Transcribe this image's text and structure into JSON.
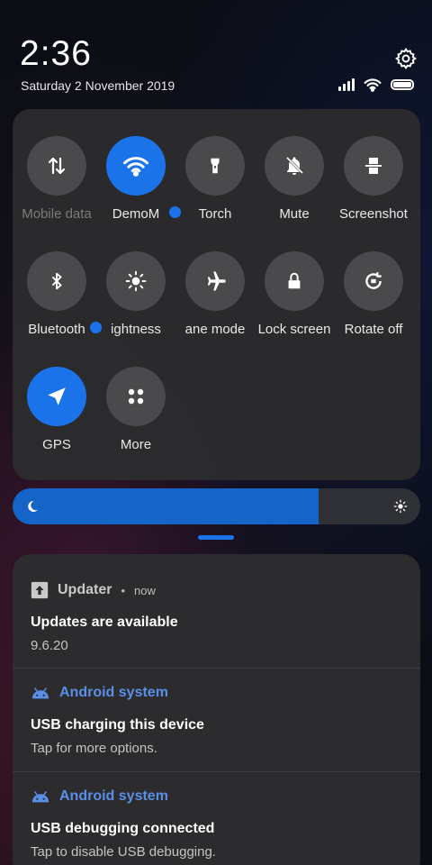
{
  "status_bar": {
    "time": "2:36",
    "date": "Saturday 2 November 2019",
    "settings_icon": "gear-icon",
    "signal_icon": "signal-bars-icon",
    "wifi_icon": "wifi-icon",
    "battery_icon": "battery-icon"
  },
  "quick_settings": {
    "tiles": [
      {
        "label": "Mobile data",
        "icon": "mobile-data-icon",
        "state": "unavailable"
      },
      {
        "label": "DemoM",
        "icon": "wifi-icon",
        "state": "on"
      },
      {
        "label": "Torch",
        "icon": "torch-icon",
        "state": "off"
      },
      {
        "label": "Mute",
        "icon": "bell-off-icon",
        "state": "off"
      },
      {
        "label": "Screenshot",
        "icon": "screenshot-icon",
        "state": "off"
      },
      {
        "label": "Bluetooth",
        "icon": "bluetooth-icon",
        "state": "off"
      },
      {
        "label": "ightness",
        "icon": "brightness-icon",
        "state": "off"
      },
      {
        "label": "ane mode",
        "icon": "airplane-icon",
        "state": "off"
      },
      {
        "label": "Lock screen",
        "icon": "lock-icon",
        "state": "off"
      },
      {
        "label": "Rotate off",
        "icon": "rotate-lock-icon",
        "state": "off"
      },
      {
        "label": "GPS",
        "icon": "navigation-arrow-icon",
        "state": "on"
      },
      {
        "label": "More",
        "icon": "grid-dots-icon",
        "state": "off"
      }
    ]
  },
  "brightness": {
    "level": 0.75,
    "accent": "#1565c8"
  },
  "notifications": [
    {
      "app": "Updater",
      "time": "now",
      "title": "Updates are available",
      "body": "9.6.20",
      "icon": "upload-arrow-icon"
    },
    {
      "app": "Android system",
      "title": "USB charging this device",
      "body": "Tap for more options.",
      "icon": "android-icon"
    },
    {
      "app": "Android system",
      "title": "USB debugging connected",
      "body": "Tap to disable USB debugging.",
      "icon": "android-icon"
    }
  ],
  "colors": {
    "accent": "#1a73e8",
    "tile_off": "#4a4a4c",
    "panel": "#2c2c2e",
    "android_app": "#5b8ee6"
  }
}
